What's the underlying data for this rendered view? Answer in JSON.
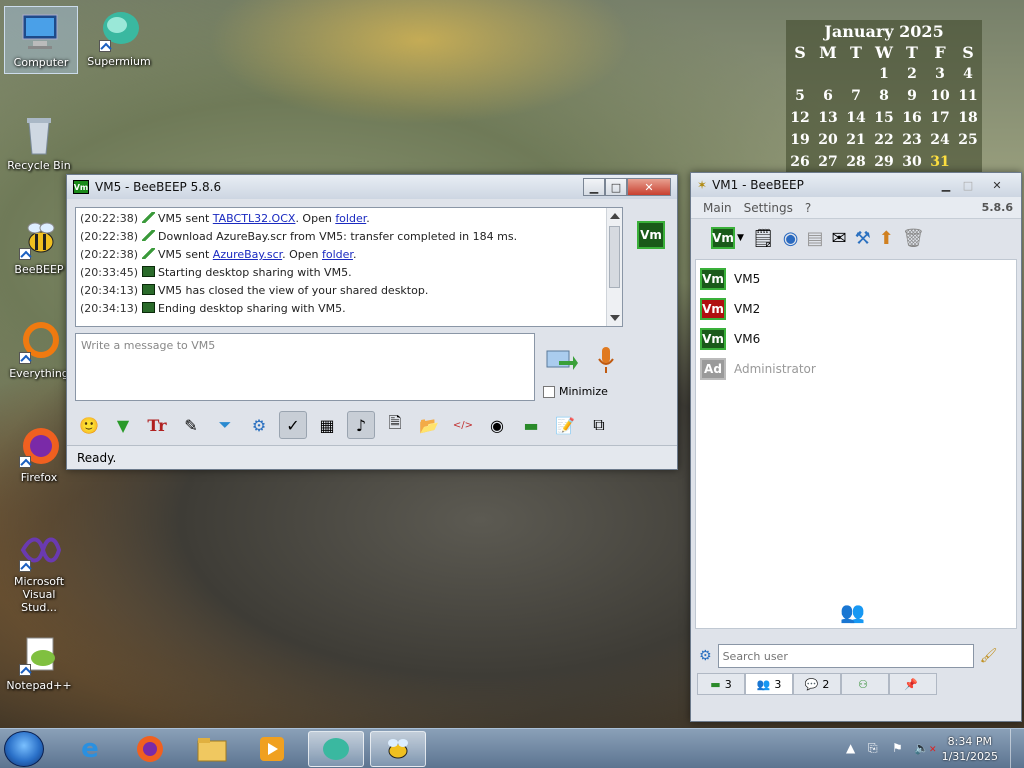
{
  "desktop": {
    "icons": [
      {
        "label": "Computer",
        "icon": "computer-icon"
      },
      {
        "label": "Supermium",
        "icon": "supermium-icon"
      },
      {
        "label": "Recycle Bin",
        "icon": "recycle-bin-icon"
      },
      {
        "label": "BeeBEEP",
        "icon": "beebeep-icon"
      },
      {
        "label": "Everything",
        "icon": "everything-icon"
      },
      {
        "label": "Firefox",
        "icon": "firefox-icon"
      },
      {
        "label": "Microsoft Visual Stud...",
        "icon": "visual-studio-icon"
      },
      {
        "label": "Notepad++",
        "icon": "notepadpp-icon"
      }
    ]
  },
  "calendar": {
    "title": "January 2025",
    "days": [
      "S",
      "M",
      "T",
      "W",
      "T",
      "F",
      "S"
    ],
    "weeks": [
      [
        "",
        "",
        "",
        "1",
        "2",
        "3",
        "4"
      ],
      [
        "5",
        "6",
        "7",
        "8",
        "9",
        "10",
        "11"
      ],
      [
        "12",
        "13",
        "14",
        "15",
        "16",
        "17",
        "18"
      ],
      [
        "19",
        "20",
        "21",
        "22",
        "23",
        "24",
        "25"
      ],
      [
        "26",
        "27",
        "28",
        "29",
        "30",
        "31",
        ""
      ]
    ],
    "today": "31"
  },
  "chat_window": {
    "title": "VM5 - BeeBEEP 5.8.6",
    "badge": "Vm",
    "log": [
      {
        "ts": "(20:22:38)",
        "icon": "arrow",
        "pre": "VM5 sent ",
        "link": "TABCTL32.OCX",
        "mid": ". Open ",
        "link2": "folder",
        "post": "."
      },
      {
        "ts": "(20:22:38)",
        "icon": "arrow",
        "pre": "Download AzureBay.scr from VM5: transfer completed in 184 ms.",
        "link": "",
        "mid": "",
        "link2": "",
        "post": ""
      },
      {
        "ts": "(20:22:38)",
        "icon": "arrow",
        "pre": "VM5 sent ",
        "link": "AzureBay.scr",
        "mid": ". Open ",
        "link2": "folder",
        "post": "."
      },
      {
        "ts": "(20:33:45)",
        "icon": "screen",
        "pre": "Starting desktop sharing with VM5.",
        "link": "",
        "mid": "",
        "link2": "",
        "post": ""
      },
      {
        "ts": "(20:34:13)",
        "icon": "screen",
        "pre": "VM5 has closed the view of your shared desktop.",
        "link": "",
        "mid": "",
        "link2": "",
        "post": ""
      },
      {
        "ts": "(20:34:13)",
        "icon": "screen",
        "pre": "Ending desktop sharing with VM5.",
        "link": "",
        "mid": "",
        "link2": "",
        "post": ""
      }
    ],
    "message_placeholder": "Write a message to VM5",
    "minimize_label": "Minimize",
    "status": "Ready."
  },
  "main_window": {
    "title": "VM1 - BeeBEEP",
    "menu": [
      "Main",
      "Settings",
      "?"
    ],
    "version": "5.8.6",
    "users": [
      {
        "badge": "Vm",
        "name": "VM5",
        "status": "green"
      },
      {
        "badge": "Vm",
        "name": "VM2",
        "status": "red"
      },
      {
        "badge": "Vm",
        "name": "VM6",
        "status": "green"
      },
      {
        "badge": "Ad",
        "name": "Administrator",
        "status": "offline"
      }
    ],
    "search_placeholder": "Search user",
    "tabs": [
      {
        "icon": "chat-tab-icon",
        "count": "3"
      },
      {
        "icon": "users-tab-icon",
        "count": "3"
      },
      {
        "icon": "groups-tab-icon",
        "count": "2"
      },
      {
        "icon": "network-tab-icon",
        "count": ""
      },
      {
        "icon": "pin-tab-icon",
        "count": ""
      }
    ]
  },
  "taskbar": {
    "time": "8:34 PM",
    "date": "1/31/2025"
  }
}
